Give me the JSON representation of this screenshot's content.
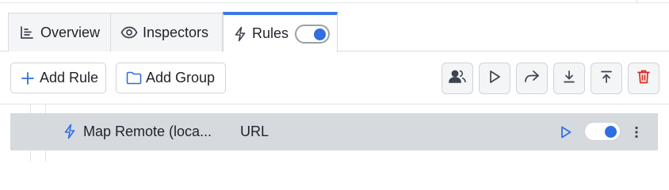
{
  "tabs": [
    {
      "label": "Overview",
      "icon": "chart-icon"
    },
    {
      "label": "Inspectors",
      "icon": "eye-icon"
    },
    {
      "label": "Rules",
      "icon": "bolt-icon",
      "active": true,
      "toggle_on": true
    }
  ],
  "toolbar": {
    "add_rule_label": "Add Rule",
    "add_group_label": "Add Group",
    "icon_buttons": [
      "users-icon",
      "play-icon",
      "share-icon",
      "download-icon",
      "upload-icon",
      "trash-icon"
    ]
  },
  "rules": [
    {
      "name": "Map Remote (loca...",
      "type": "URL",
      "enabled": true
    }
  ],
  "colors": {
    "accent": "#2f6fdf",
    "tab_active_top": "#3b7ae0",
    "danger": "#d92d20",
    "row_bg": "#d6d9de"
  }
}
